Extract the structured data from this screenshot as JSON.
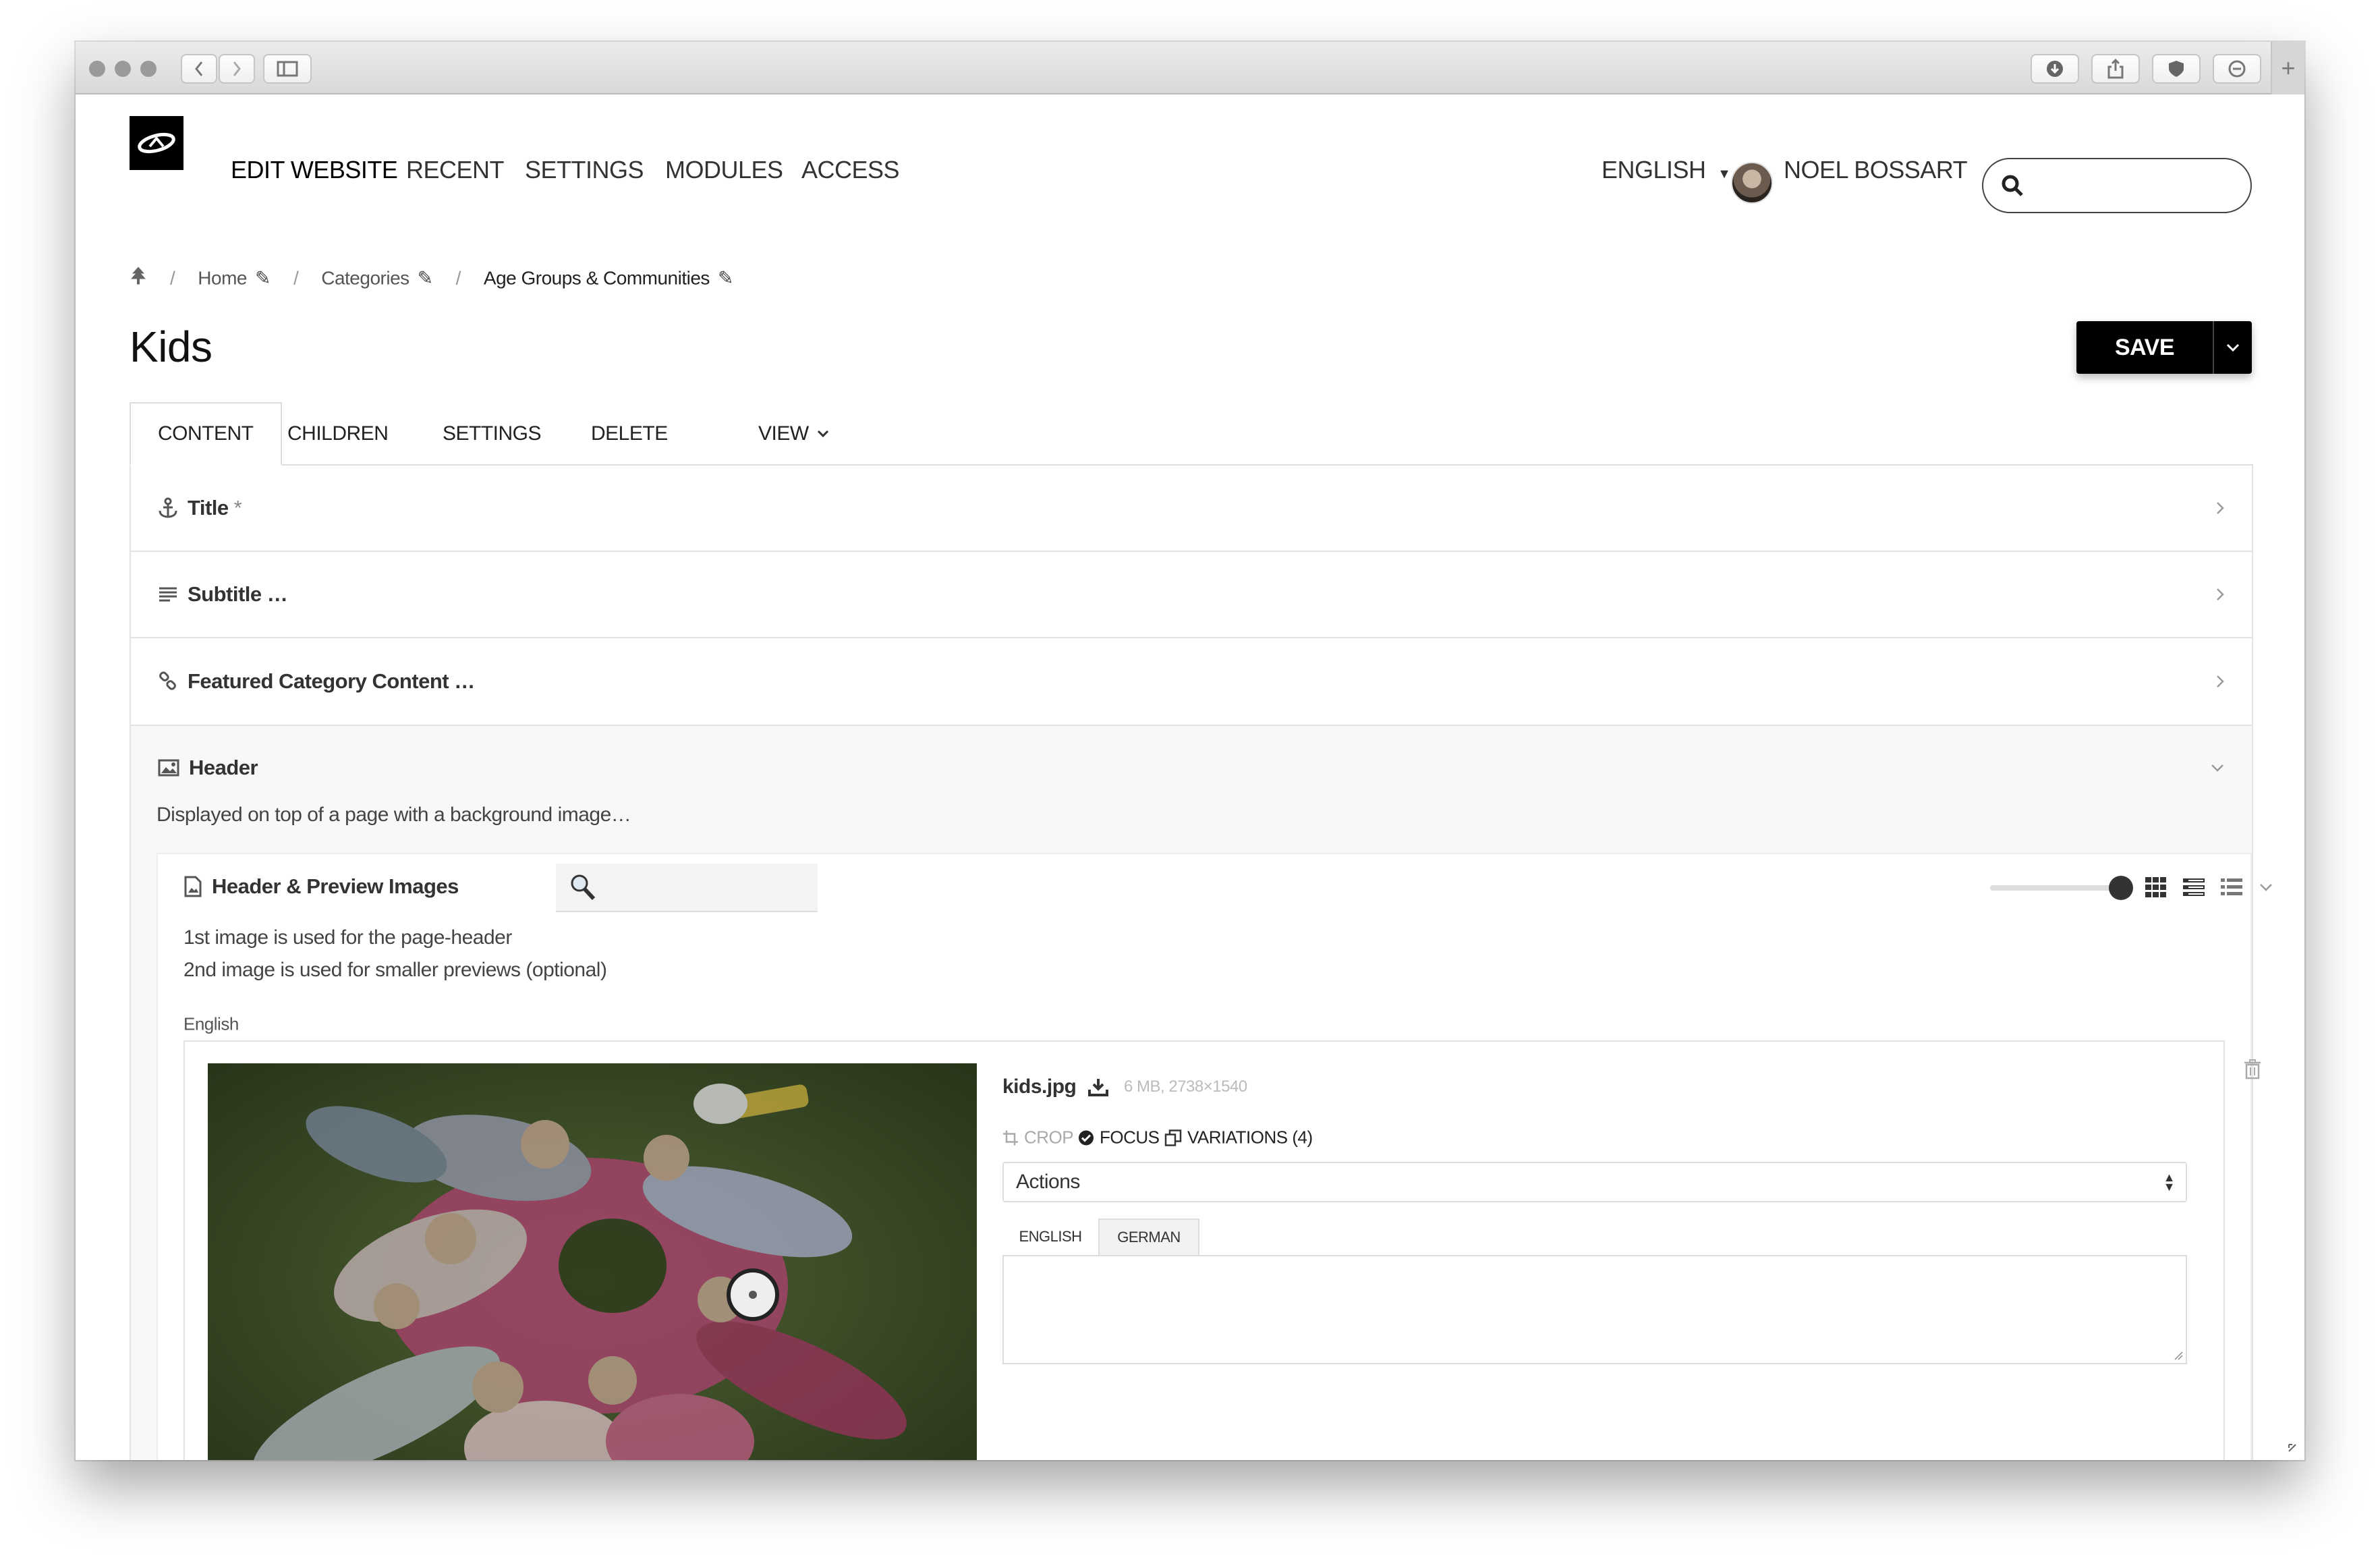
{
  "nav": {
    "items": [
      "EDIT WEBSITE",
      "RECENT",
      "SETTINGS",
      "MODULES",
      "ACCESS"
    ]
  },
  "header": {
    "language": "ENGLISH",
    "user_name": "NOEL BOSSART",
    "search_placeholder": ""
  },
  "breadcrumb": [
    "Home",
    "Categories",
    "Age Groups & Communities"
  ],
  "page": {
    "title": "Kids",
    "save_label": "SAVE"
  },
  "tabs": [
    "CONTENT",
    "CHILDREN",
    "SETTINGS",
    "DELETE",
    "VIEW"
  ],
  "sections": {
    "title": {
      "label": "Title",
      "marker": "*"
    },
    "subtitle": {
      "label": "Subtitle …"
    },
    "featured": {
      "label": "Featured Category Content …"
    },
    "header": {
      "label": "Header",
      "description": "Displayed on top of a page with a background image…"
    }
  },
  "gallery": {
    "title": "Header & Preview Images",
    "help_line_1": "1st image is used for the page-header",
    "help_line_2": "2nd image is used for smaller previews (optional)",
    "language_label": "English",
    "file": {
      "name": "kids.jpg",
      "meta": "6 MB, 2738×1540"
    },
    "actions": {
      "crop": "CROP",
      "focus": "FOCUS",
      "variations": "VARIATIONS (4)"
    },
    "select_value": "Actions",
    "lang_tabs": [
      "ENGLISH",
      "GERMAN"
    ]
  },
  "colors": {
    "accent": "#000000",
    "section_bg": "#f8f8f8",
    "border": "#e3e3e3"
  }
}
